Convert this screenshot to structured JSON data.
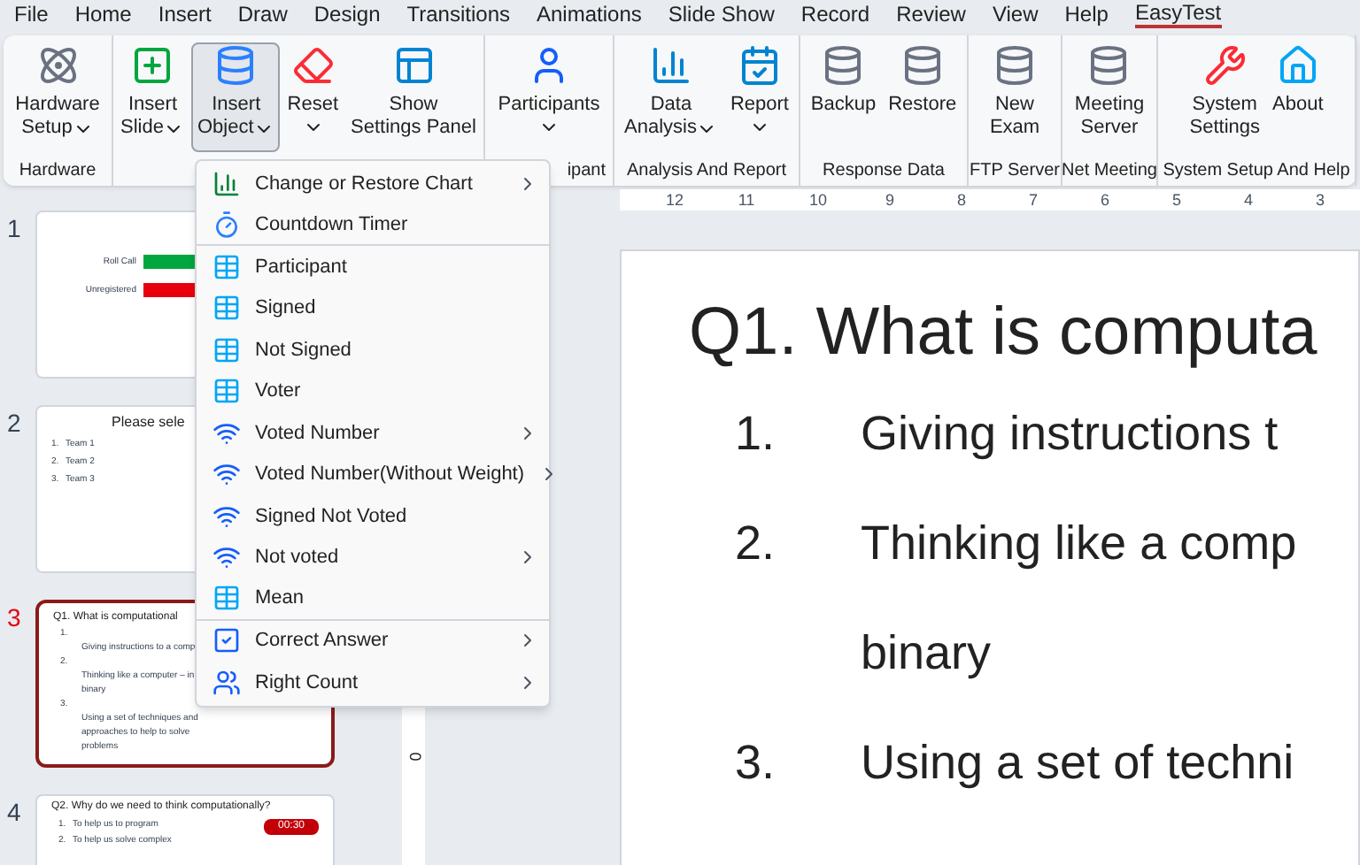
{
  "menu_bar": [
    {
      "label": "File",
      "selected": false
    },
    {
      "label": "Home",
      "selected": false
    },
    {
      "label": "Insert",
      "selected": false
    },
    {
      "label": "Draw",
      "selected": false
    },
    {
      "label": "Design",
      "selected": false
    },
    {
      "label": "Transitions",
      "selected": false
    },
    {
      "label": "Animations",
      "selected": false
    },
    {
      "label": "Slide Show",
      "selected": false
    },
    {
      "label": "Record",
      "selected": false
    },
    {
      "label": "Review",
      "selected": false
    },
    {
      "label": "View",
      "selected": false
    },
    {
      "label": "Help",
      "selected": false
    },
    {
      "label": "EasyTest",
      "selected": true
    }
  ],
  "ribbon_groups": [
    {
      "label": "Hardware",
      "buttons": [
        {
          "kind": "atom",
          "lines": [
            "Hardware",
            "Setup"
          ],
          "dropdown": true,
          "selected": false
        }
      ]
    },
    {
      "buttons": [
        {
          "kind": "slide-add",
          "lines": [
            "Insert",
            "Slide"
          ],
          "dropdown": true,
          "selected": false
        },
        {
          "kind": "db-add",
          "lines": [
            "Insert",
            "Object"
          ],
          "dropdown": true,
          "selected": true
        },
        {
          "kind": "eraser",
          "lines": [
            "Reset"
          ],
          "dropdown": true,
          "selected": false
        },
        {
          "kind": "panel",
          "lines": [
            "Show",
            "Settings Panel"
          ],
          "dropdown": false,
          "selected": false
        }
      ]
    },
    {
      "label": "ipant",
      "buttons": [
        {
          "kind": "person",
          "lines": [
            "Participants"
          ],
          "dropdown": true,
          "selected": false
        }
      ]
    },
    {
      "label": "Analysis And Report",
      "buttons": [
        {
          "kind": "chart",
          "lines": [
            "Data",
            "Analysis"
          ],
          "dropdown": true,
          "selected": false
        },
        {
          "kind": "report",
          "lines": [
            "Report"
          ],
          "dropdown": true,
          "selected": false
        }
      ]
    },
    {
      "label": "Response Data",
      "buttons": [
        {
          "kind": "db-arrow",
          "lines": [
            "Backup"
          ],
          "dropdown": false,
          "selected": false
        },
        {
          "kind": "db-add2",
          "lines": [
            "Restore"
          ],
          "dropdown": false,
          "selected": false
        }
      ]
    },
    {
      "label": "FTP Server",
      "buttons": [
        {
          "kind": "db-add2",
          "lines": [
            "New",
            "Exam"
          ],
          "dropdown": false,
          "selected": false
        }
      ]
    },
    {
      "label": "Net Meeting",
      "buttons": [
        {
          "kind": "db-add2",
          "lines": [
            "Meeting",
            "Server"
          ],
          "dropdown": false,
          "selected": false
        }
      ]
    },
    {
      "label": "System Setup And Help",
      "buttons": [
        {
          "kind": "tools",
          "lines": [
            "System",
            "Settings"
          ],
          "dropdown": false,
          "selected": false
        },
        {
          "kind": "home",
          "lines": [
            "About"
          ],
          "dropdown": false,
          "selected": false
        }
      ]
    }
  ],
  "dropdown_menu": [
    {
      "kind": "chart",
      "label": "Change or Restore Chart",
      "submenu": true,
      "separator_after": false
    },
    {
      "kind": "timer",
      "label": "Countdown Timer",
      "submenu": false,
      "separator_after": true
    },
    {
      "kind": "table",
      "label": "Participant",
      "submenu": false,
      "separator_after": false
    },
    {
      "kind": "table",
      "label": "Signed",
      "submenu": false,
      "separator_after": false
    },
    {
      "kind": "table",
      "label": "Not Signed",
      "submenu": false,
      "separator_after": false
    },
    {
      "kind": "table",
      "label": "Voter",
      "submenu": false,
      "separator_after": false
    },
    {
      "kind": "signal",
      "label": "Voted Number",
      "submenu": true,
      "separator_after": false
    },
    {
      "kind": "signal",
      "label": "Voted Number(Without Weight)",
      "submenu": true,
      "separator_after": false
    },
    {
      "kind": "signal",
      "label": "Signed Not Voted",
      "submenu": false,
      "separator_after": false
    },
    {
      "kind": "signal",
      "label": "Not voted",
      "submenu": true,
      "separator_after": false
    },
    {
      "kind": "table",
      "label": "Mean",
      "submenu": false,
      "separator_after": true
    },
    {
      "kind": "check",
      "label": "Correct Answer",
      "submenu": true,
      "separator_after": false
    },
    {
      "kind": "count",
      "label": "Right Count",
      "submenu": true,
      "separator_after": false
    }
  ],
  "slides": [
    {
      "number": "1",
      "selected": false,
      "kind": "rollcall",
      "lines": [
        "Roll Call",
        "Unregistered"
      ]
    },
    {
      "number": "2",
      "selected": false,
      "kind": "teams",
      "title": "Please sele",
      "lines": [
        "1.",
        "Team 1",
        "2.",
        "Team 2",
        "3.",
        "Team 3"
      ]
    },
    {
      "number": "3",
      "selected": true,
      "kind": "question",
      "title": "Q1. What is computational",
      "lines": [
        "1.",
        "Giving instructions to a comp",
        "2.",
        "Thinking like a computer – in",
        "binary",
        "3.",
        "Using a set of techniques and",
        "approaches to help to solve",
        "problems"
      ]
    },
    {
      "number": "4",
      "selected": false,
      "kind": "timer",
      "title": "Q2. Why do we need to think computationally?",
      "lines": [
        "1.",
        "To help us to program",
        "2.",
        "To help us solve complex"
      ],
      "timer": "00:30"
    }
  ],
  "ruler": [
    "12",
    "11",
    "10",
    "9",
    "8",
    "7",
    "6",
    "5",
    "4",
    "3"
  ],
  "vertical_ruler": [
    "0"
  ],
  "slide": {
    "title": "Q1. What is computa",
    "items": [
      {
        "number": "1.",
        "text": "Giving instructions t"
      },
      {
        "number": "2.",
        "text": "Thinking like a comp"
      },
      {
        "text": "binary"
      },
      {
        "number": "3.",
        "text": "Using a set of techni"
      }
    ]
  }
}
